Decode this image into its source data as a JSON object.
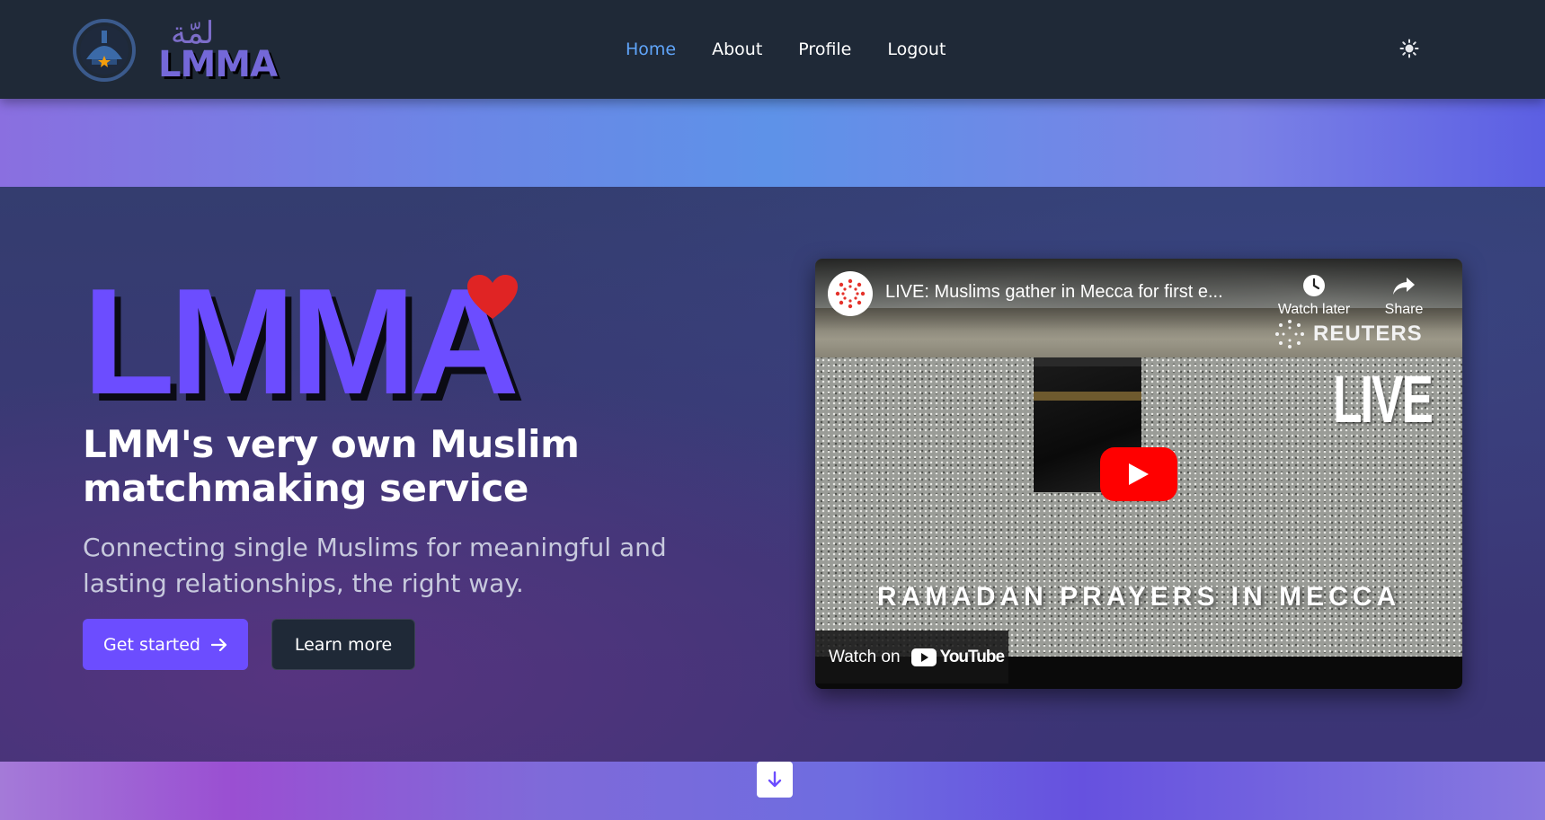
{
  "nav": {
    "brand_arabic": "لمّة",
    "brand_text": "LMMA",
    "links": [
      {
        "label": "Home",
        "active": true
      },
      {
        "label": "About",
        "active": false
      },
      {
        "label": "Profile",
        "active": false
      },
      {
        "label": "Logout",
        "active": false
      }
    ],
    "theme_icon": "sun-icon"
  },
  "hero": {
    "brand": "LMMA",
    "headline": "LMM's very own Muslim matchmaking service",
    "subheadline": "Connecting single Muslims for meaningful and lasting relationships, the right way.",
    "primary_button": "Get started",
    "secondary_button": "Learn more"
  },
  "video": {
    "title": "LIVE: Muslims gather in Mecca for first e...",
    "watch_later": "Watch later",
    "share": "Share",
    "publisher": "REUTERS",
    "live": "LIVE",
    "caption": "RAMADAN PRAYERS IN MECCA",
    "watch_on": "Watch on",
    "platform": "YouTube"
  },
  "colors": {
    "accent": "#6c4dff",
    "nav_active": "#60a5fa",
    "navbar_bg": "#1f2937",
    "heart": "#e02424",
    "youtube_red": "#ff0000"
  }
}
